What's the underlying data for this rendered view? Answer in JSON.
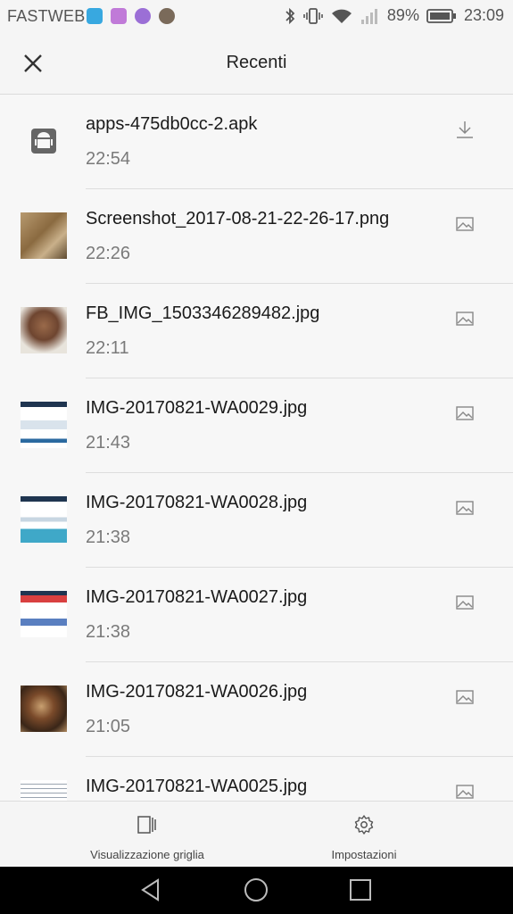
{
  "status_bar": {
    "carrier": "FASTWEB",
    "battery": "89%",
    "time": "23:09"
  },
  "header": {
    "title": "Recenti"
  },
  "files": [
    {
      "name": "apps-475db0cc-2.apk",
      "time": "22:54",
      "type": "download"
    },
    {
      "name": "Screenshot_2017-08-21-22-26-17.png",
      "time": "22:26",
      "type": "image"
    },
    {
      "name": "FB_IMG_1503346289482.jpg",
      "time": "22:11",
      "type": "image"
    },
    {
      "name": "IMG-20170821-WA0029.jpg",
      "time": "21:43",
      "type": "image"
    },
    {
      "name": "IMG-20170821-WA0028.jpg",
      "time": "21:38",
      "type": "image"
    },
    {
      "name": "IMG-20170821-WA0027.jpg",
      "time": "21:38",
      "type": "image"
    },
    {
      "name": "IMG-20170821-WA0026.jpg",
      "time": "21:05",
      "type": "image"
    },
    {
      "name": "IMG-20170821-WA0025.jpg",
      "time": "",
      "type": "image"
    }
  ],
  "bottom_bar": {
    "grid_label": "Visualizzazione griglia",
    "settings_label": "Impostazioni"
  }
}
